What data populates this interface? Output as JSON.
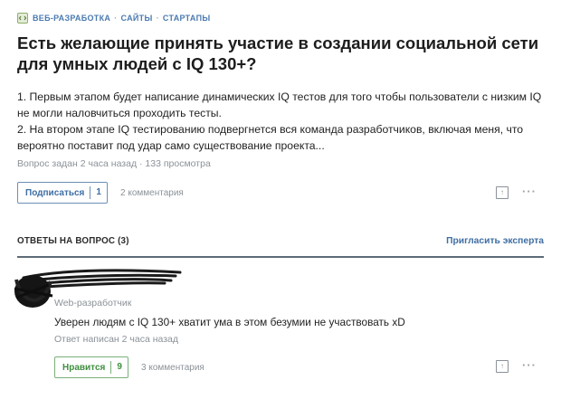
{
  "tags": [
    "ВЕБ-РАЗРАБОТКА",
    "САЙТЫ",
    "СТАРТАПЫ"
  ],
  "tag_separator": "·",
  "question": {
    "title": "Есть желающие принять участие в создании социальной сети для умных людей с IQ 130+?",
    "body": [
      "1. Первым этапом будет написание динамических IQ тестов для того чтобы пользователи с низким IQ не могли наловчиться проходить тесты.",
      "2. На втором этапе IQ тестированию подвергнется вся команда разработчиков, включая меня, что вероятно поставит под удар само существование проекта..."
    ],
    "meta": "Вопрос задан 2 часа назад · 133 просмотра",
    "subscribe_label": "Подписаться",
    "subscribe_count": "1",
    "comments_label": "2 комментария",
    "share_icon_glyph": "↑",
    "more_glyph": "···"
  },
  "answers_section": {
    "title": "ОТВЕТЫ НА ВОПРОС (3)",
    "invite_label": "Пригласить эксперта"
  },
  "answer": {
    "role": "Web-разработчик",
    "text": "Уверен людям с IQ 130+ хватит ума в этом безумии не участвовать xD",
    "meta": "Ответ написан 2 часа назад",
    "like_label": "Нравится",
    "like_count": "9",
    "comments_label": "3 комментария",
    "share_icon_glyph": "↑",
    "more_glyph": "···"
  },
  "colors": {
    "link": "#3e6ea3",
    "muted": "#8b9298",
    "like_green": "#3f8f3f"
  },
  "icons": {
    "tag_icon": "code-icon",
    "share_icon": "share-icon",
    "more_icon": "more-icon",
    "redaction": "redaction-scribble"
  }
}
